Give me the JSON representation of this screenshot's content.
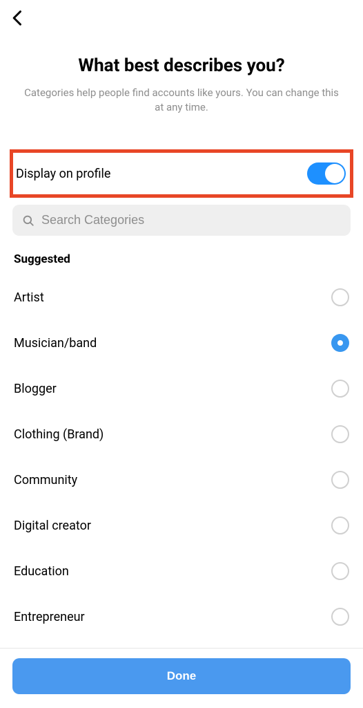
{
  "header": {
    "title": "What best describes you?",
    "subtitle": "Categories help people find accounts like yours. You can change this at any time."
  },
  "toggle": {
    "label": "Display on profile",
    "on": true
  },
  "search": {
    "placeholder": "Search Categories"
  },
  "section_header": "Suggested",
  "categories": [
    {
      "label": "Artist",
      "selected": false
    },
    {
      "label": "Musician/band",
      "selected": true
    },
    {
      "label": "Blogger",
      "selected": false
    },
    {
      "label": "Clothing (Brand)",
      "selected": false
    },
    {
      "label": "Community",
      "selected": false
    },
    {
      "label": "Digital creator",
      "selected": false
    },
    {
      "label": "Education",
      "selected": false
    },
    {
      "label": "Entrepreneur",
      "selected": false
    }
  ],
  "footer": {
    "done_label": "Done"
  }
}
